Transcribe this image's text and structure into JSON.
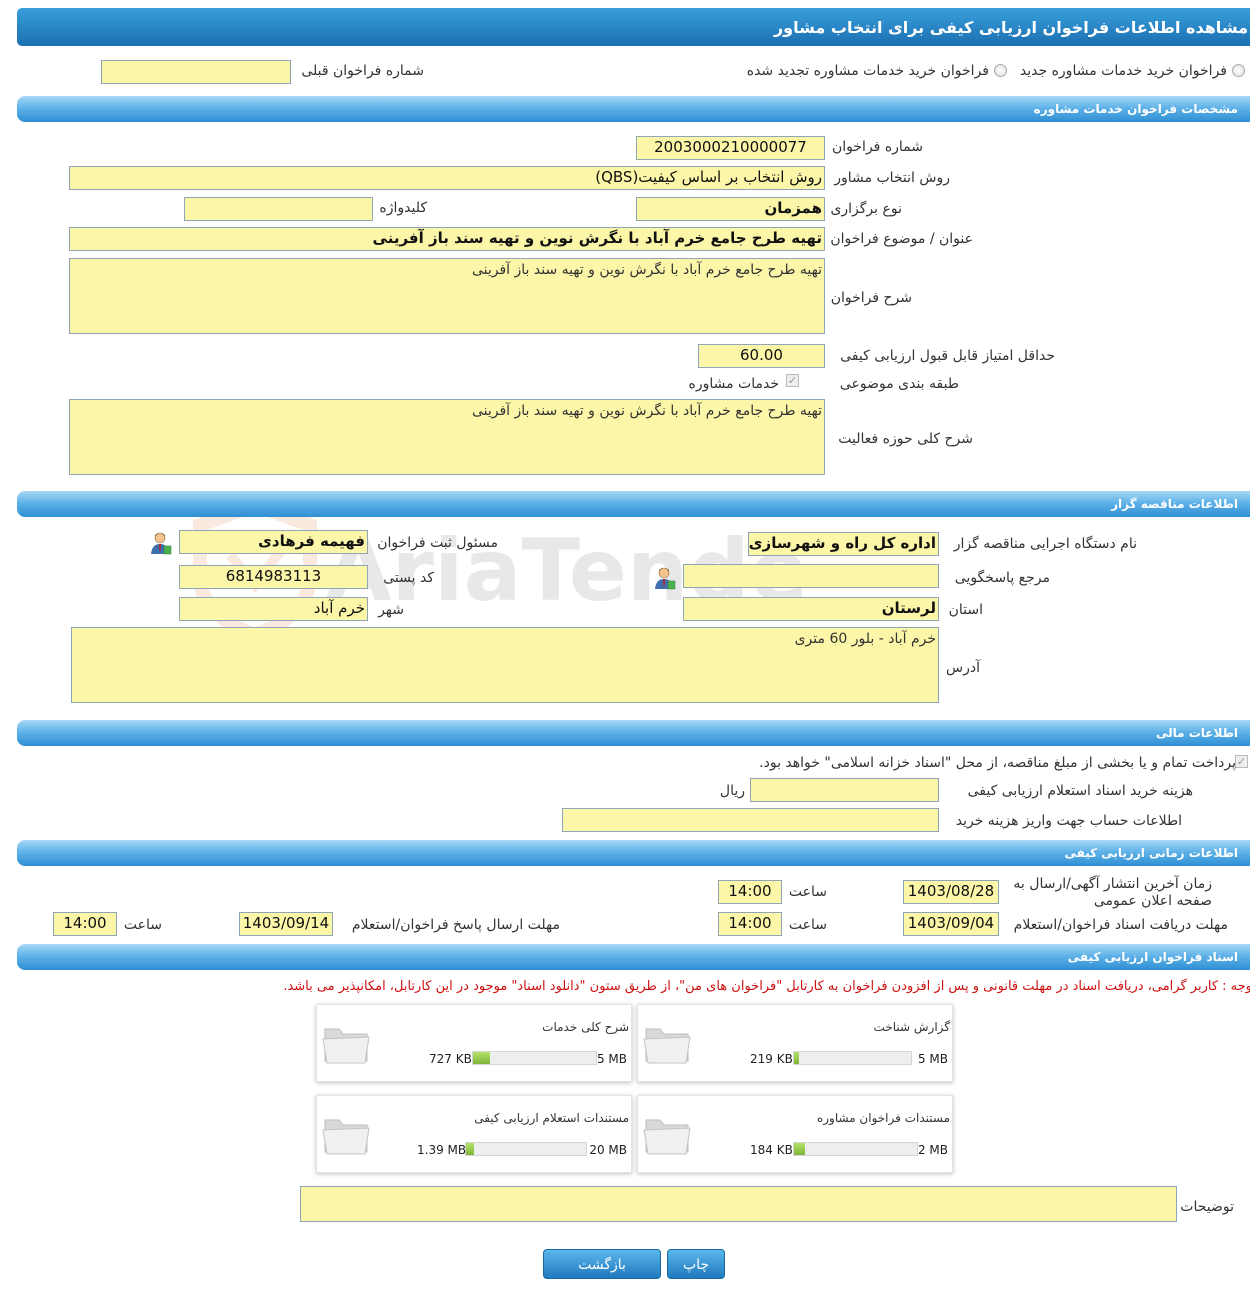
{
  "page_title": "مشاهده اطلاعات فراخوان ارزیابی کیفی برای انتخاب مشاور",
  "top": {
    "radio_new": "فراخوان خرید خدمات مشاوره جدید",
    "radio_renewed": "فراخوان خرید خدمات مشاوره تجدید شده",
    "prev_call_label": "شماره فراخوان قبلی",
    "prev_call_value": ""
  },
  "sections": {
    "consult": "مشخصات فراخوان خدمات مشاوره",
    "tenderer": "اطلاعات مناقصه گزار",
    "financial": "اطلاعات مالی",
    "timing": "اطلاعات زمانی ارزیابی کیفی",
    "docs": "اسناد فراخوان ارزیابی کیفی"
  },
  "consult": {
    "call_number_label": "شماره فراخوان",
    "call_number": "2003000210000077",
    "method_label": "روش انتخاب مشاور",
    "method": "روش انتخاب بر اساس کیفیت(QBS)",
    "type_label": "نوع برگزاری",
    "type": "همزمان",
    "keyword_label": "کلیدواژه",
    "keyword": "",
    "subject_label": "عنوان / موضوع فراخوان",
    "subject": "تهیه طرح جامع خرم آباد با نگرش نوین و تهیه سند باز آفرینی",
    "desc_label": "شرح فراخوان",
    "desc": "تهیه طرح جامع خرم آباد با نگرش نوین و تهیه سند باز آفرینی",
    "min_score_label": "حداقل امتیاز قابل قبول ارزیابی کیفی",
    "min_score": "60.00",
    "category_label": "طبقه بندی موضوعی",
    "category_item": "خدمات مشاوره",
    "activity_label": "شرح کلی حوزه فعالیت",
    "activity": "تهیه طرح جامع خرم آباد با نگرش نوین و تهیه سند باز آفرینی"
  },
  "tenderer": {
    "org_label": "نام دستگاه اجرایی مناقصه گزار",
    "org": "اداره کل راه و شهرسازی اس",
    "officer_label": "مسئول ثبت فراخوان",
    "officer": "فهیمه فرهادی",
    "ref_label": "مرجع پاسخگویی",
    "ref": "",
    "postal_label": "کد پستی",
    "postal": "6814983113",
    "province_label": "استان",
    "province": "لرستان",
    "city_label": "شهر",
    "city": "خرم آباد",
    "address_label": "آدرس",
    "address": "خرم آباد - بلور 60 متری"
  },
  "financial": {
    "treasury_note": "پرداخت تمام و یا بخشی از مبلغ مناقصه، از محل \"اسناد خزانه اسلامی\" خواهد بود.",
    "doc_fee_label": "هزینه خرید اسناد استعلام ارزیابی کیفی",
    "doc_fee": "",
    "currency": "ریال",
    "account_label": "اطلاعات حساب جهت واریز هزینه خرید",
    "account": ""
  },
  "timing": {
    "publish_label": "زمان آخرین انتشار آگهی/ارسال به صفحه اعلان عمومی",
    "publish_date": "1403/08/28",
    "time_label": "ساعت",
    "publish_time": "14:00",
    "receive_label": "مهلت دریافت اسناد فراخوان/استعلام",
    "receive_date": "1403/09/04",
    "receive_time": "14:00",
    "answer_label": "مهلت ارسال پاسخ فراخوان/استعلام",
    "answer_date": "1403/09/14",
    "answer_time": "14:00"
  },
  "docs": {
    "notice": "توجه : کاربر گرامی، دریافت اسناد در مهلت قانونی و پس از افزودن فراخوان به کارتابل \"فراخوان های من\"، از طریق ستون \"دانلود اسناد\" موجود در این کارتابل، امکانپذیر می باشد.",
    "files": [
      {
        "title": "گزارش شناخت",
        "size": "219 KB",
        "max": "5 MB",
        "fill": 0.04
      },
      {
        "title": "شرح کلی خدمات",
        "size": "727 KB",
        "max": "5 MB",
        "fill": 0.14
      },
      {
        "title": "مستندات فراخوان مشاوره",
        "size": "184 KB",
        "max": "2 MB",
        "fill": 0.09
      },
      {
        "title": "مستندات استعلام ارزیابی کیفی",
        "size": "1.39 MB",
        "max": "20 MB",
        "fill": 0.07
      }
    ],
    "notes_label": "توضیحات",
    "notes": ""
  },
  "buttons": {
    "print": "چاپ",
    "back": "بازگشت"
  },
  "colors": {
    "field_bg": "#fbf6a8",
    "header_blue": "#1b6fb1",
    "notice_red": "#d01010",
    "progress_green": "#8bc34a"
  }
}
